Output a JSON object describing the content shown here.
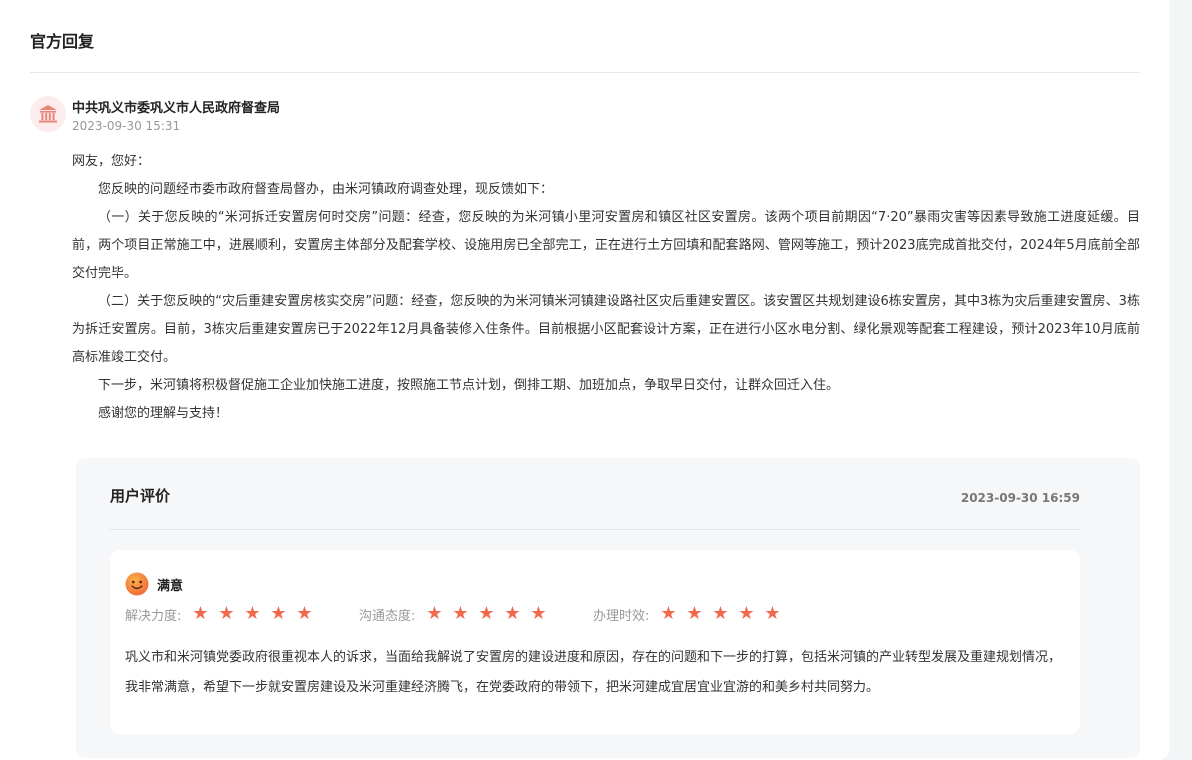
{
  "section_title": "官方回复",
  "reply": {
    "department": "中共巩义市委巩义市人民政府督查局",
    "time": "2023-09-30 15:31",
    "paragraphs": [
      "网友，您好：",
      "您反映的问题经市委市政府督查局督办，由米河镇政府调查处理，现反馈如下：",
      "（一）关于您反映的“米河拆迁安置房何时交房”问题：经查，您反映的为米河镇小里河安置房和镇区社区安置房。该两个项目前期因“7·20”暴雨灾害等因素导致施工进度延缓。目前，两个项目正常施工中，进展顺利，安置房主体部分及配套学校、设施用房已全部完工，正在进行土方回填和配套路网、管网等施工，预计2023底完成首批交付，2024年5月底前全部交付完毕。",
      "（二）关于您反映的“灾后重建安置房核实交房”问题：经查，您反映的为米河镇米河镇建设路社区灾后重建安置区。该安置区共规划建设6栋安置房，其中3栋为灾后重建安置房、3栋为拆迁安置房。目前，3栋灾后重建安置房已于2022年12月具备装修入住条件。目前根据小区配套设计方案，正在进行小区水电分割、绿化景观等配套工程建设，预计2023年10月底前高标准竣工交付。",
      "下一步，米河镇将积极督促施工企业加快施工进度，按照施工节点计划，倒排工期、加班加点，争取早日交付，让群众回迁入住。",
      "感谢您的理解与支持！"
    ]
  },
  "evaluation": {
    "title": "用户评价",
    "time": "2023-09-30 16:59",
    "satisfaction": "满意",
    "ratings": [
      {
        "label": "解决力度:",
        "stars": 5
      },
      {
        "label": "沟通态度:",
        "stars": 5
      },
      {
        "label": "办理时效:",
        "stars": 5
      }
    ],
    "comment": "巩义市和米河镇党委政府很重视本人的诉求，当面给我解说了安置房的建设进度和原因，存在的问题和下一步的打算，包括米河镇的产业转型发展及重建规划情况，我非常满意，希望下一步就安置房建设及米河重建经济腾飞，在党委政府的带领下，把米河建成宜居宜业宜游的和美乡村共同努力。"
  },
  "colors": {
    "star": "#f06a4e",
    "avatar_bg": "#fdecec",
    "avatar_icon": "#e9857a",
    "face": "#f27a3e"
  },
  "icons": {
    "avatar": "government-building-icon",
    "face": "smile-face-icon",
    "star": "star-icon"
  }
}
